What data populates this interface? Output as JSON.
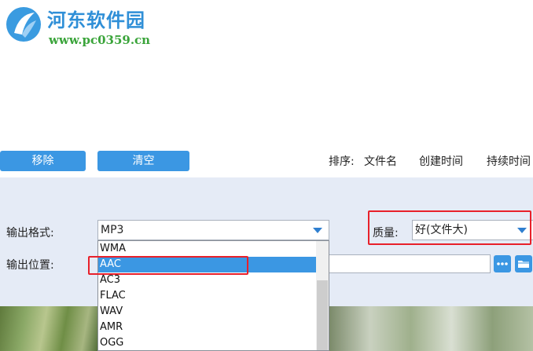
{
  "watermark": {
    "title": "河东软件园",
    "url": "www.pc0359.cn"
  },
  "toolbar": {
    "remove_label": "移除",
    "clear_label": "清空",
    "sort_label": "排序:",
    "sort_options": [
      "文件名",
      "创建时间",
      "持续时间"
    ]
  },
  "settings": {
    "output_format_label": "输出格式:",
    "output_format_value": "MP3",
    "quality_label": "质量:",
    "quality_value": "好(文件大)",
    "output_location_label": "输出位置:",
    "browse_icon": "more-dots-icon",
    "folder_icon": "folder-icon"
  },
  "format_dropdown": {
    "options": [
      "WMA",
      "AAC",
      "AC3",
      "FLAC",
      "WAV",
      "AMR",
      "OGG"
    ],
    "highlighted": "AAC"
  },
  "colors": {
    "accent": "#3b97e3",
    "panel": "#e5ebf6",
    "annotation": "#e8202a"
  }
}
